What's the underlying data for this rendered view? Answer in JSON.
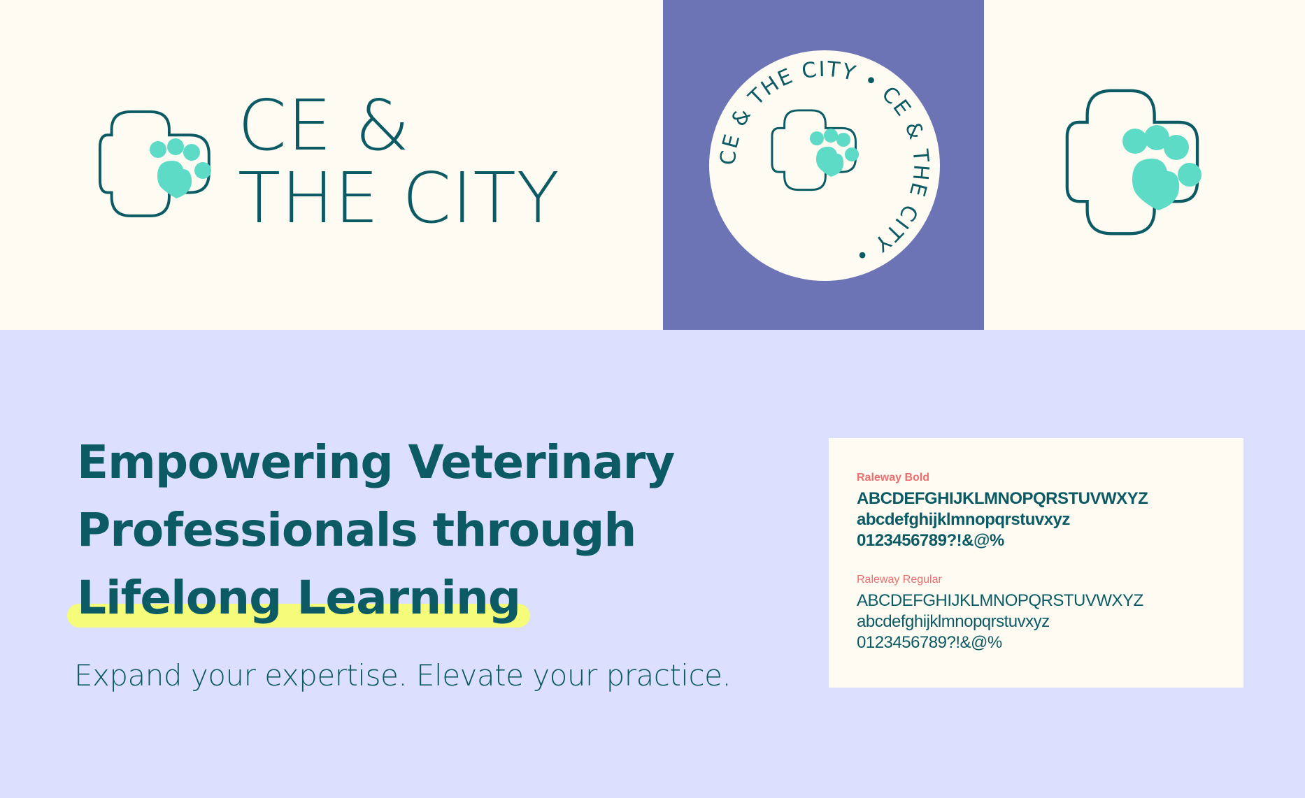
{
  "brand": {
    "line1": "CE &",
    "line2": "THE CITY",
    "badge_text": "CE & THE CITY • CE & THE CITY • "
  },
  "colors": {
    "cream": "#fdfbf2",
    "periwinkle": "#6d74b6",
    "lavender": "#dcdffe",
    "teal": "#0c5a64",
    "mint": "#5edbc6",
    "highlight": "#f4fc7a",
    "coral": "#ec6f6f"
  },
  "headline": {
    "line1": "Empowering Veterinary",
    "line2": "Professionals through",
    "line3": "Lifelong Learning"
  },
  "subline": "Expand your expertise. Elevate your practice.",
  "typography": {
    "bold": {
      "label": "Raleway Bold",
      "upper": "ABCDEFGHIJKLMNOPQRSTUVWXYZ",
      "lower": "abcdefghijklmnopqrstuvxyz",
      "digits": "0123456789?!&@%"
    },
    "regular": {
      "label": "Raleway Regular",
      "upper": "ABCDEFGHIJKLMNOPQRSTUVWXYZ",
      "lower": "abcdefghijklmnopqrstuvxyz",
      "digits": "0123456789?!&@%"
    }
  }
}
